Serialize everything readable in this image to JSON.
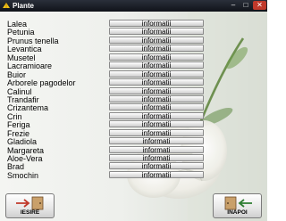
{
  "window": {
    "title": "Plante"
  },
  "plants": [
    {
      "name": "Lalea",
      "button": "informatii"
    },
    {
      "name": "Petunia",
      "button": "informatii"
    },
    {
      "name": "Prunus tenella",
      "button": "informatii"
    },
    {
      "name": "Levantica",
      "button": "informatii"
    },
    {
      "name": "Musetel",
      "button": "informatii"
    },
    {
      "name": "Lacramioare",
      "button": "informatii"
    },
    {
      "name": "Buior",
      "button": "informatii"
    },
    {
      "name": "Arborele pagodelor",
      "button": "informatii"
    },
    {
      "name": "Calinul",
      "button": "informatii"
    },
    {
      "name": "Trandafir",
      "button": "informatii"
    },
    {
      "name": "Crizantema",
      "button": "informatii"
    },
    {
      "name": "Crin",
      "button": "informatii"
    },
    {
      "name": "Feriga",
      "button": "informatii"
    },
    {
      "name": "Frezie",
      "button": "informatii"
    },
    {
      "name": "Gladiola",
      "button": "informati"
    },
    {
      "name": "Margareta",
      "button": "informati"
    },
    {
      "name": "Aloe-Vera",
      "button": "informati"
    },
    {
      "name": "Brad",
      "button": "informatii"
    },
    {
      "name": "Smochin",
      "button": "informatii"
    }
  ],
  "footer": {
    "exit_label": "IESIRE",
    "back_label": "INAPOI"
  }
}
